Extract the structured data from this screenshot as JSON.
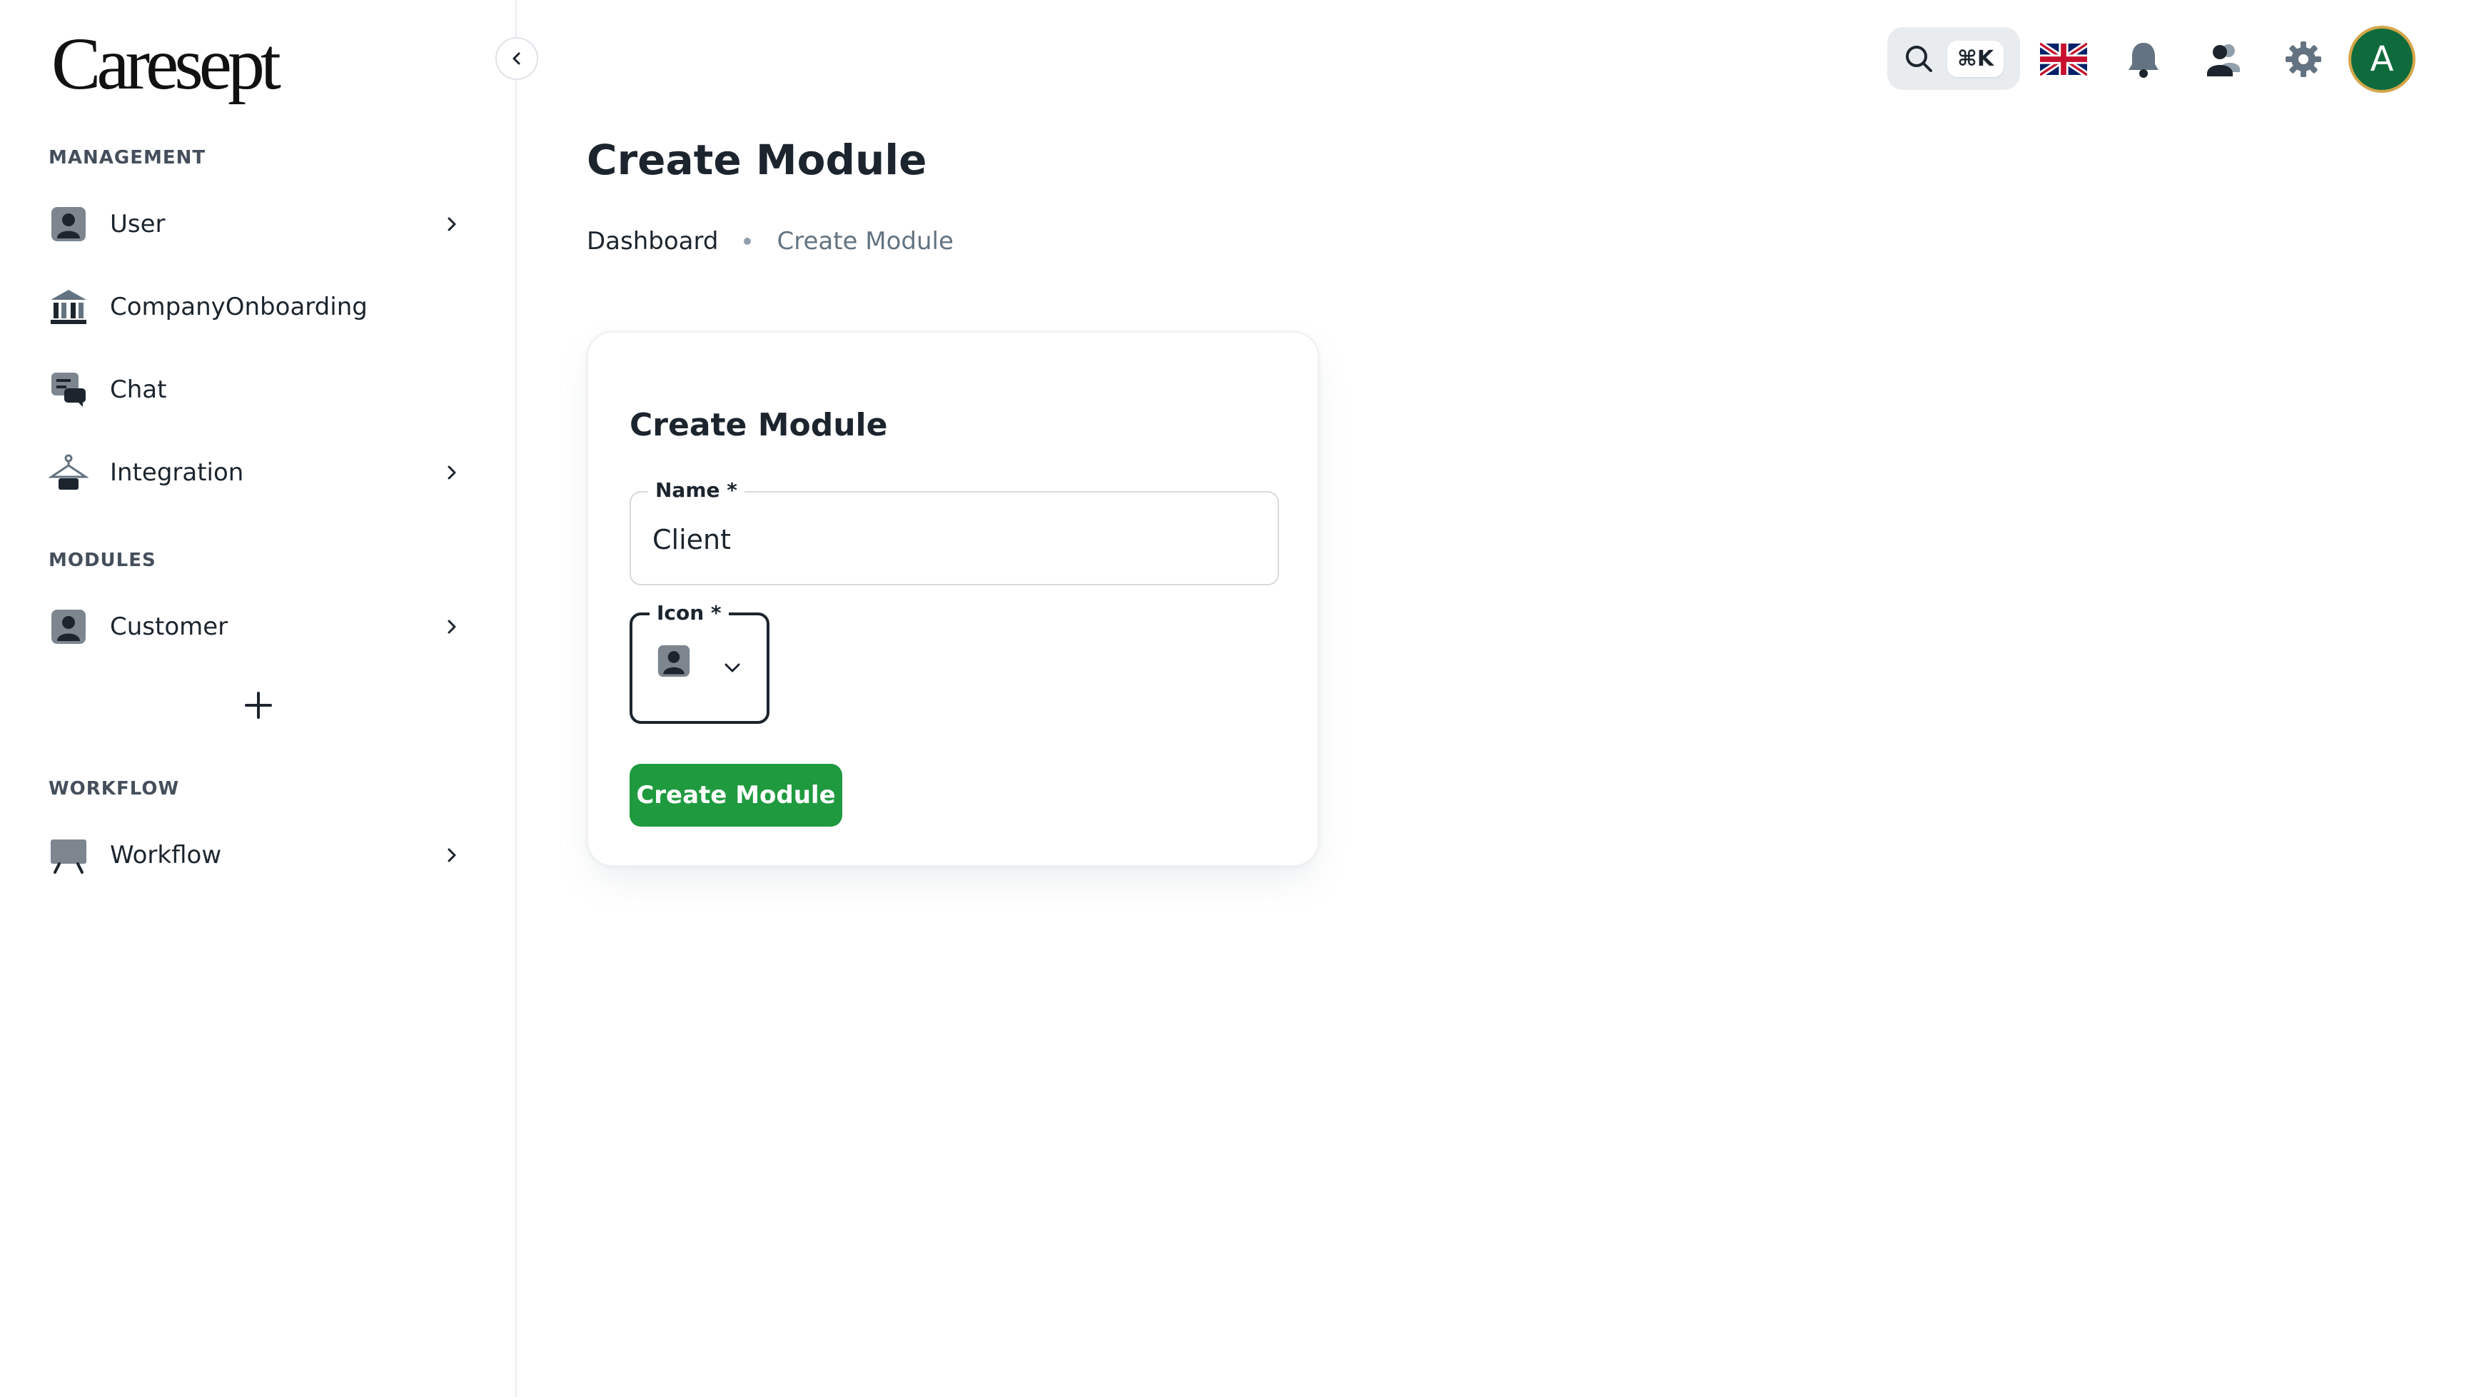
{
  "app": {
    "logo_text": "Caresept"
  },
  "sidebar": {
    "sections": [
      {
        "label": "MANAGEMENT"
      },
      {
        "label": "MODULES"
      },
      {
        "label": "WORKFLOW"
      }
    ],
    "management_items": [
      {
        "label": "User",
        "icon": "user-badge-icon",
        "has_children": true
      },
      {
        "label": "CompanyOnboarding",
        "icon": "bank-icon",
        "has_children": false
      },
      {
        "label": "Chat",
        "icon": "chat-icon",
        "has_children": false
      },
      {
        "label": "Integration",
        "icon": "hanger-icon",
        "has_children": true
      }
    ],
    "module_items": [
      {
        "label": "Customer",
        "icon": "user-badge-icon",
        "has_children": true
      }
    ],
    "workflow_items": [
      {
        "label": "Workflow",
        "icon": "presentation-board-icon",
        "has_children": true
      }
    ]
  },
  "topbar": {
    "search_shortcut": "⌘K",
    "avatar_initial": "A",
    "avatar_bg": "#0f6b3c"
  },
  "page": {
    "title": "Create Module",
    "breadcrumb": {
      "root": "Dashboard",
      "current": "Create Module"
    }
  },
  "form": {
    "title": "Create Module",
    "name_label": "Name *",
    "name_value": "Client",
    "icon_label": "Icon *",
    "icon_selected": "user-badge-icon",
    "submit_label": "Create Module",
    "submit_color": "#1f9a3f"
  }
}
